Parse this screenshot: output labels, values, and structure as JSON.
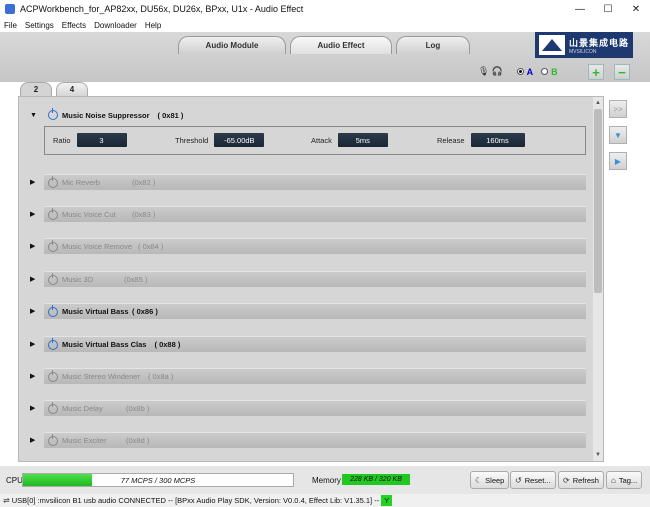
{
  "window": {
    "title": "ACPWorkbench_for_AP82xx, DU56x, DU26x, BPxx, U1x - Audio Effect",
    "minimize": "—",
    "maximize": "☐",
    "close": "✕"
  },
  "menu": [
    "File",
    "Settings",
    "Effects",
    "Downloader",
    "Help"
  ],
  "top_tabs": [
    {
      "label": "Audio Module",
      "active": false
    },
    {
      "label": "Audio Effect",
      "active": true
    },
    {
      "label": "Log",
      "active": false
    }
  ],
  "logo": {
    "cn": "山景集成电路",
    "en": "MVSILICON"
  },
  "ab_select": {
    "a_label": "A",
    "b_label": "B",
    "selected": "A"
  },
  "header_buttons": {
    "plus": "+",
    "minus": "−"
  },
  "sub_tabs": [
    {
      "label": "2",
      "active": true
    },
    {
      "label": "4",
      "active": false
    }
  ],
  "effects": [
    {
      "name": "Music Noise Suppressor",
      "id": "( 0x81 )",
      "enabled": true,
      "expanded": true
    },
    {
      "name": "Mic Reverb",
      "id": "(0x82 )",
      "enabled": false,
      "expanded": false
    },
    {
      "name": "Music Voice Cut",
      "id": "(0x83 )",
      "enabled": false,
      "expanded": false
    },
    {
      "name": "Music Voice Remove",
      "id": "( 0x84 )",
      "enabled": false,
      "expanded": false
    },
    {
      "name": "Music 3D",
      "id": "(0x85 )",
      "enabled": false,
      "expanded": false
    },
    {
      "name": "Music Virtual Bass",
      "id": "( 0x86 )",
      "enabled": true,
      "expanded": false
    },
    {
      "name": "Music Virtual Bass Clas",
      "id": "( 0x88 )",
      "enabled": true,
      "expanded": false
    },
    {
      "name": "Music Stereo Windener",
      "id": "( 0x8a )",
      "enabled": false,
      "expanded": false
    },
    {
      "name": "Music Delay",
      "id": "(0x8b )",
      "enabled": false,
      "expanded": false
    },
    {
      "name": "Music Exciter",
      "id": "(0x8d )",
      "enabled": false,
      "expanded": false
    }
  ],
  "params": [
    {
      "label": "Ratio",
      "value": "3"
    },
    {
      "label": "Threshold",
      "value": "-65.00dB"
    },
    {
      "label": "Attack",
      "value": "5ms"
    },
    {
      "label": "Release",
      "value": "160ms"
    }
  ],
  "side_buttons": {
    "fast": ">>",
    "down": "▼",
    "right": "▶"
  },
  "cpu": {
    "label": "CPU",
    "text": "77 MCPS / 300 MCPS",
    "used": 77,
    "total": 300
  },
  "memory": {
    "label": "Memory",
    "text": "228 KB / 320 KB"
  },
  "actions": [
    {
      "label": "Sleep",
      "icon": "moon-icon"
    },
    {
      "label": "Reset...",
      "icon": "reset-icon"
    },
    {
      "label": "Refresh",
      "icon": "refresh-icon"
    },
    {
      "label": "Tag...",
      "icon": "tag-icon"
    }
  ],
  "status": {
    "text": "USB[0] :mvsilicon B1 usb audio CONNECTED -- [BPxx Audio Play SDK,  Version: V0.0.4,  Effect Lib: V1.35.1] --",
    "flag": "Y"
  },
  "colors": {
    "accent": "#2e6fd0",
    "green": "#22c822",
    "logo_bg": "#1d3970"
  }
}
